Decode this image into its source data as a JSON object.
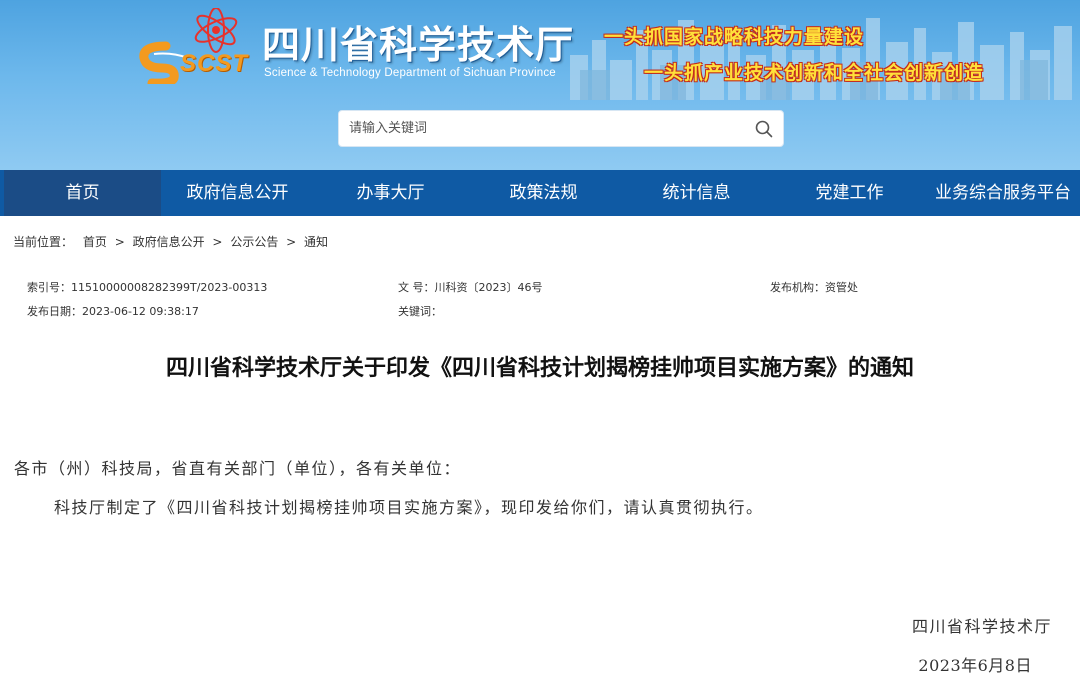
{
  "header": {
    "logo_text": "SCST",
    "site_title": "四川省科学技术厅",
    "site_subtitle": "Science & Technology Department of Sichuan Province",
    "slogan_1": "一头抓国家战略科技力量建设",
    "slogan_2": "一头抓产业技术创新和全社会创新创造",
    "colors": {
      "header_blue": "#5aaae6",
      "slogan_yellow": "#ffe13a",
      "slogan_red": "#c42b1c",
      "nav_blue": "#0f5aa4",
      "nav_active": "#1b4c86"
    }
  },
  "search": {
    "placeholder": "请输入关键词",
    "icon": "search-icon"
  },
  "nav": {
    "items": [
      {
        "label": "首页",
        "active": true
      },
      {
        "label": "政府信息公开",
        "active": false
      },
      {
        "label": "办事大厅",
        "active": false
      },
      {
        "label": "政策法规",
        "active": false
      },
      {
        "label": "统计信息",
        "active": false
      },
      {
        "label": "党建工作",
        "active": false
      },
      {
        "label": "业务综合服务平台",
        "active": false
      }
    ]
  },
  "breadcrumb": {
    "prefix": "当前位置：",
    "items": [
      "首页",
      "政府信息公开",
      "公示公告",
      "通知"
    ],
    "separator": ">"
  },
  "meta": {
    "index_no": "索引号：11510000008282399T/2023-00313",
    "doc_no": "文 号：川科资〔2023〕46号",
    "publisher": "发布机构：资管处",
    "publish_date": "发布日期：2023-06-12 09:38:17",
    "keywords": "关键词："
  },
  "article": {
    "title": "四川省科学技术厅关于印发《四川省科技计划揭榜挂帅项目实施方案》的通知",
    "salutation": "各市（州）科技局，省直有关部门（单位），各有关单位：",
    "paragraph_1": "科技厅制定了《四川省科技计划揭榜挂帅项目实施方案》，现印发给你们，请认真贯彻执行。",
    "signature": "四川省科学技术厅",
    "date": "2023年6月8日"
  }
}
